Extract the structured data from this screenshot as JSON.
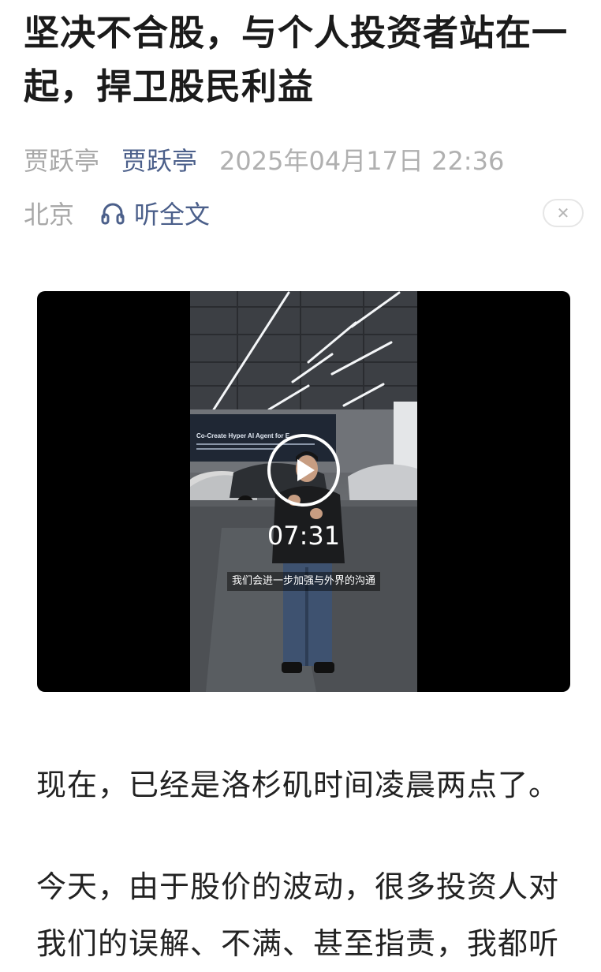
{
  "article": {
    "title": "坚决不合股，与个人投资者站在一起，捍卫股民利益",
    "account": "贾跃亭",
    "author": "贾跃亭",
    "datetime": "2025年04月17日 22:36",
    "location": "北京",
    "listen_label": "听全文",
    "close_label": "✕"
  },
  "video": {
    "duration": "07:31",
    "subtitle": "我们会进一步加强与外界的沟通",
    "poster_text": "Co-Create Hyper AI Agent for E"
  },
  "paragraphs": [
    "现在，已经是洛杉矶时间凌晨两点了。",
    "今天，由于股价的波动，很多投资人对我们的误解、不满、甚至指责，我都听"
  ],
  "colors": {
    "title": "#1b1b1b",
    "meta_gray": "#a8a8a8",
    "link_blue": "#4b5f8a"
  }
}
